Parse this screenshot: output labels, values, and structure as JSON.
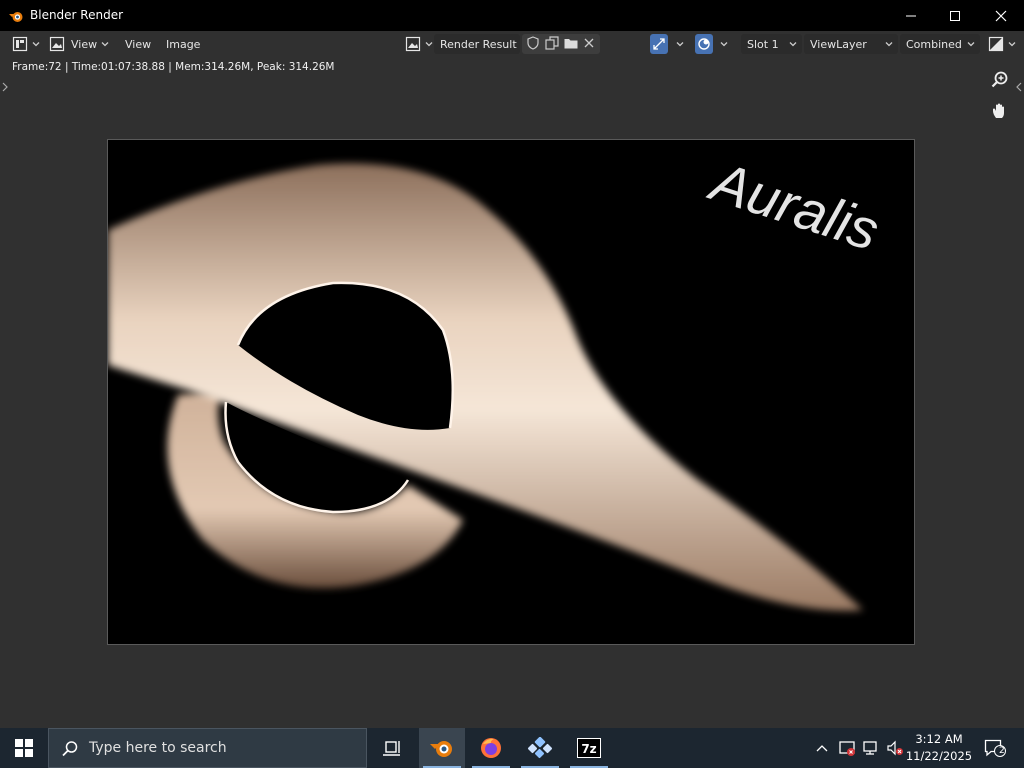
{
  "window": {
    "title": "Blender Render"
  },
  "header": {
    "view_menu": "View",
    "view_menu2": "View",
    "image_menu": "Image",
    "image_name": "Render Result",
    "slot": "Slot 1",
    "view_layer": "ViewLayer",
    "pass": "Combined"
  },
  "stats": {
    "text": "Frame:72 | Time:01:07:38.88 | Mem:314.26M, Peak: 314.26M"
  },
  "render": {
    "logo_text": "Auralis"
  },
  "taskbar": {
    "search_placeholder": "Type here to search",
    "time": "3:12 AM",
    "date": "11/22/2025",
    "notification_count": "2"
  },
  "colors": {
    "accent_blue": "#4772b3",
    "editor_bg": "#303030",
    "taskbar_bg": "#1c2630"
  }
}
